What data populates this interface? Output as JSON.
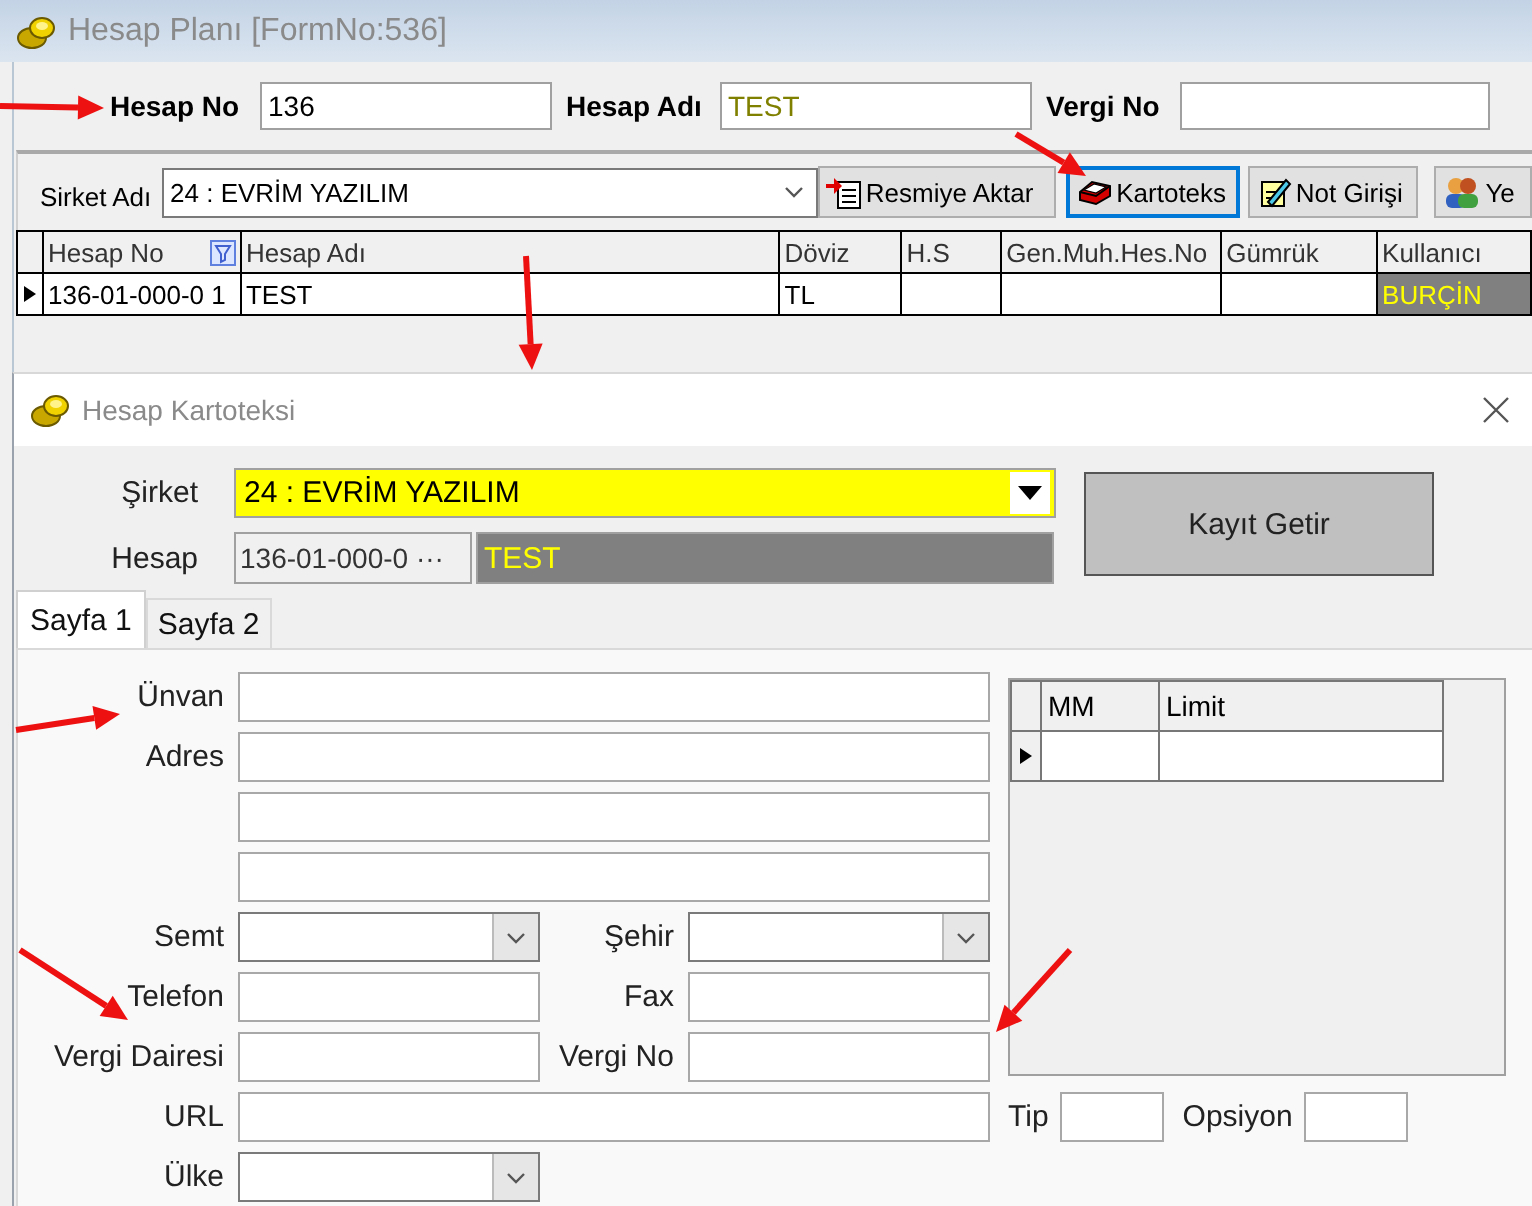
{
  "main_window": {
    "title": "Hesap Planı [FormNo:536]",
    "filters": [
      {
        "label": "Hesap No",
        "value": "136"
      },
      {
        "label": "Hesap Adı",
        "value": "TEST"
      },
      {
        "label": "Vergi No"
      }
    ],
    "company": {
      "label": "Sirket Adı",
      "value": "24 : EVRİM YAZILIM"
    },
    "toolbar": [
      {
        "label": "Resmiye Aktar",
        "focused": false
      },
      {
        "label": "Kartoteks",
        "focused": true
      },
      {
        "label": "Not Girişi",
        "focused": false
      },
      {
        "label": "Ye",
        "focused": false
      }
    ],
    "table": {
      "columns": [
        "Hesap No",
        "Hesap Adı",
        "Döviz",
        "H.S",
        "Gen.Muh.Hes.No",
        "Gümrük",
        "Kullanıcı"
      ],
      "rows": [
        {
          "current": true,
          "cells": [
            "136-01-000-0 1",
            "TEST",
            "TL",
            null,
            null,
            null,
            "BURÇİN"
          ]
        }
      ]
    }
  },
  "dialog": {
    "title": "Hesap Kartoteksi",
    "company": {
      "label": "Şirket",
      "value": "24 : EVRİM YAZILIM"
    },
    "account": {
      "label": "Hesap",
      "code": "136-01-000-0 ···",
      "name": "TEST"
    },
    "fetch_button": "Kayıt Getir",
    "tabs": [
      {
        "label": "Sayfa 1",
        "selected": true
      },
      {
        "label": "Sayfa 2",
        "selected": false
      }
    ],
    "form_rows": [
      {
        "fields": [
          {
            "label": "Ünvan",
            "kind": "text"
          }
        ]
      },
      {
        "fields": [
          {
            "label": "Adres",
            "kind": "text"
          }
        ]
      },
      {
        "fields": [
          {
            "kind": "text"
          }
        ]
      },
      {
        "fields": [
          {
            "kind": "text"
          }
        ]
      },
      {
        "fields": [
          {
            "label": "Semt",
            "kind": "combo"
          },
          {
            "label": "Şehir",
            "kind": "combo"
          }
        ]
      },
      {
        "fields": [
          {
            "label": "Telefon",
            "kind": "text"
          },
          {
            "label": "Fax",
            "kind": "text"
          }
        ]
      },
      {
        "fields": [
          {
            "label": "Vergi Dairesi",
            "kind": "text"
          },
          {
            "label": "Vergi No",
            "kind": "text"
          }
        ]
      },
      {
        "fields": [
          {
            "label": "URL",
            "kind": "text"
          },
          {
            "label": "Tip",
            "kind": "short"
          },
          {
            "label": "Opsiyon",
            "kind": "short"
          }
        ]
      },
      {
        "fields": [
          {
            "label": "Ülke",
            "kind": "combo"
          }
        ]
      }
    ],
    "limits_table": {
      "columns": [
        "MM",
        "Limit"
      ],
      "rows": [
        {
          "current": true,
          "cells": [
            null,
            null
          ]
        }
      ]
    }
  }
}
